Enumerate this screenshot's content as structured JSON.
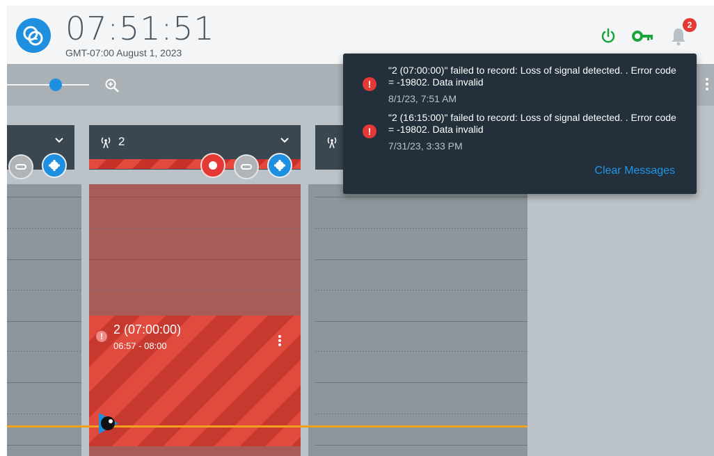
{
  "header": {
    "clock": "07:51:51",
    "date": "GMT-07:00 August 1, 2023",
    "icons": {
      "power": "power-icon",
      "key": "key-icon",
      "bell": "bell-icon",
      "more": "more-vertical-icon"
    },
    "notification_count": "2",
    "colors": {
      "status_green": "#1aa33a",
      "accent_blue": "#1f8fe0",
      "badge_red": "#e53935"
    }
  },
  "toolbar": {
    "zoom_icon": "zoom-in-icon",
    "zoom_fraction": 0.6
  },
  "channels": [
    {
      "number": ""
    },
    {
      "number": "2"
    },
    {
      "number": ""
    }
  ],
  "recording": {
    "title": "2 (07:00:00)",
    "time_range": "06:57 - 08:00"
  },
  "notifications": {
    "items": [
      {
        "message": "\"2 (07:00:00)\" failed to record: Loss of signal detected. . Error code = -19802. Data invalid",
        "time": "8/1/23, 7:51 AM"
      },
      {
        "message": "\"2 (16:15:00)\" failed to record: Loss of signal detected. . Error code = -19802. Data invalid",
        "time": "7/31/23, 3:33 PM"
      }
    ],
    "clear_label": "Clear Messages"
  }
}
